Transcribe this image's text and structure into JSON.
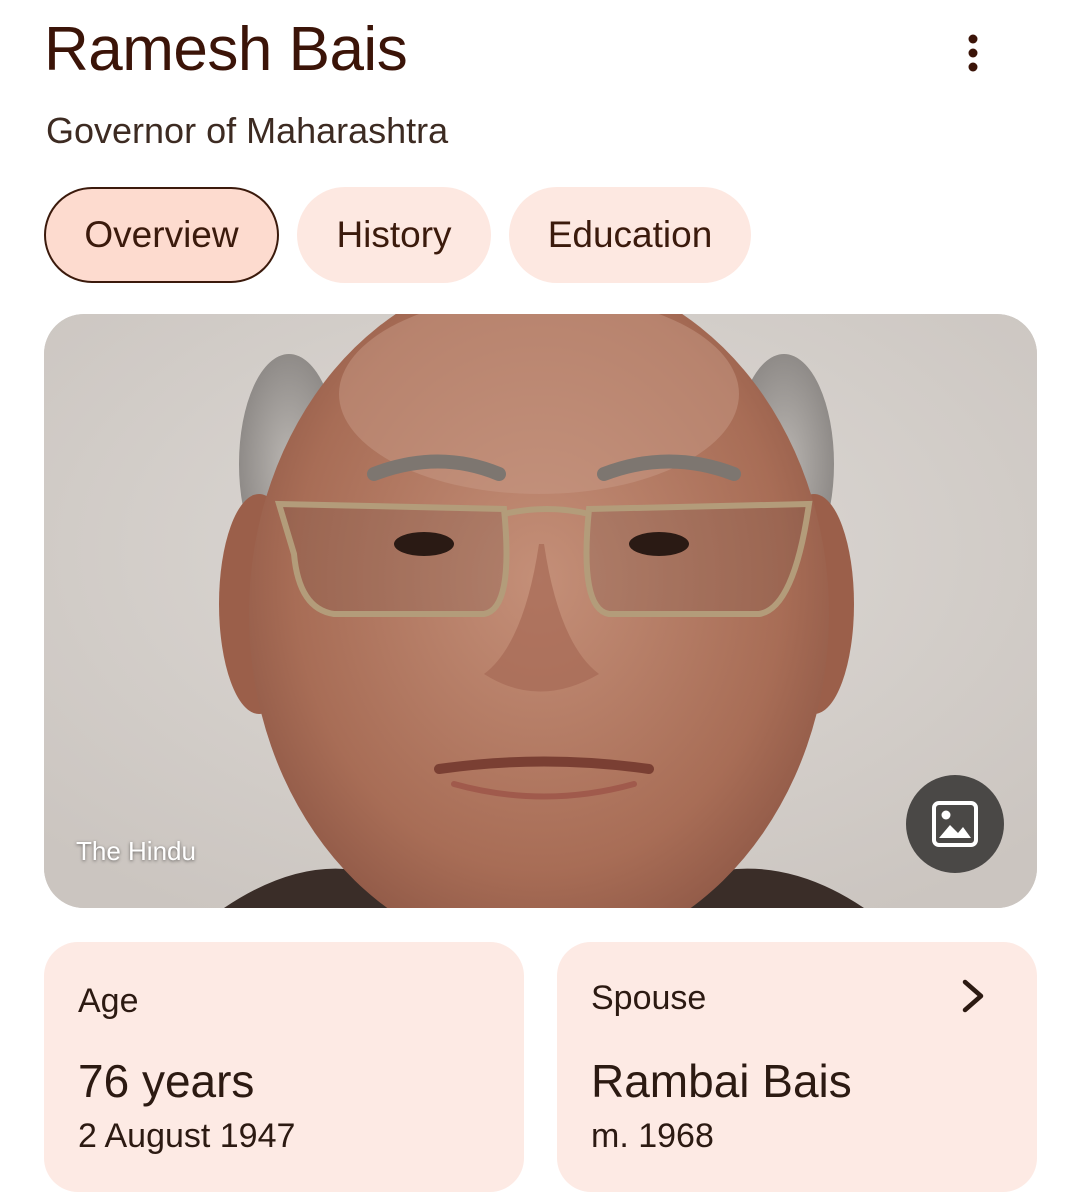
{
  "header": {
    "title": "Ramesh Bais",
    "subtitle": "Governor of Maharashtra",
    "more_icon": "more-vert-icon"
  },
  "tabs": [
    {
      "label": "Overview",
      "active": true
    },
    {
      "label": "History",
      "active": false
    },
    {
      "label": "Education",
      "active": false
    }
  ],
  "photo": {
    "source": "The Hindu",
    "image_button_icon": "image-icon"
  },
  "cards": {
    "age": {
      "label": "Age",
      "value": "76 years",
      "sub": "2 August 1947"
    },
    "spouse": {
      "label": "Spouse",
      "value": "Rambai Bais",
      "sub": "m. 1968",
      "chevron_icon": "chevron-right-icon"
    }
  },
  "colors": {
    "title": "#3b1408",
    "chip_bg": "#fde8e1",
    "chip_active_bg": "#fddbcf",
    "card_bg": "#fdeae4"
  }
}
